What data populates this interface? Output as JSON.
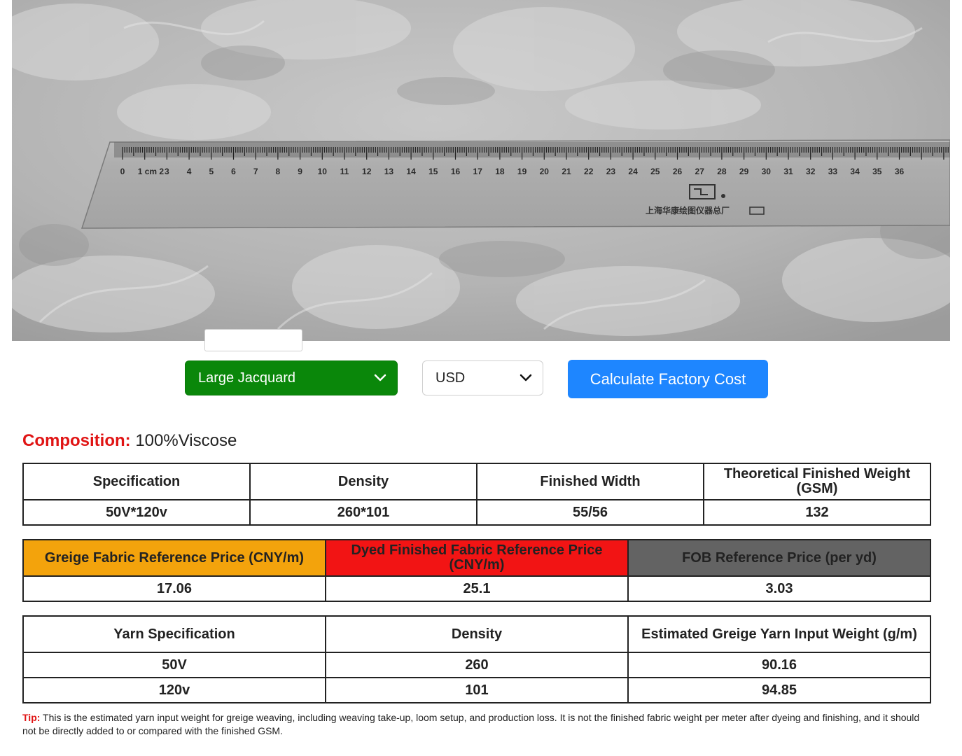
{
  "photo": {
    "ruler_numbers": [
      "0",
      "1 cm 2",
      "3",
      "4",
      "5",
      "6",
      "7",
      "8",
      "9",
      "10",
      "11",
      "12",
      "13",
      "14",
      "15",
      "16",
      "17",
      "18",
      "19",
      "20",
      "21",
      "22",
      "23",
      "24",
      "25",
      "26",
      "27",
      "28",
      "29",
      "30",
      "31",
      "32",
      "33",
      "34",
      "35",
      "36"
    ],
    "ruler_brand_text": "上海华康绘图仪器总厂"
  },
  "controls": {
    "process_select": {
      "selected": "Large Jacquard",
      "color": "#0a870a"
    },
    "currency_select": {
      "selected": "USD"
    },
    "calculate_label": "Calculate Factory Cost",
    "calculate_color": "#1e86ff"
  },
  "composition": {
    "label": "Composition:",
    "value": "100%Viscose"
  },
  "spec_table": {
    "headers": [
      "Specification",
      "Density",
      "Finished Width",
      "Theoretical Finished Weight (GSM)"
    ],
    "row": [
      "50V*120v",
      "260*101",
      "55/56",
      "132"
    ]
  },
  "price_table": {
    "headers": [
      "Greige Fabric Reference Price (CNY/m)",
      "Dyed Finished Fabric Reference Price (CNY/m)",
      "FOB Reference Price (per yd)"
    ],
    "header_colors": [
      "#f3a30c",
      "#f21414",
      "#636363"
    ],
    "row": [
      "17.06",
      "25.1",
      "3.03"
    ]
  },
  "yarn_table": {
    "headers": [
      "Yarn Specification",
      "Density",
      "Estimated Greige Yarn Input Weight (g/m)"
    ],
    "rows": [
      [
        "50V",
        "260",
        "90.16"
      ],
      [
        "120v",
        "101",
        "94.85"
      ]
    ]
  },
  "tip": {
    "label": "Tip:",
    "text": "This is the estimated yarn input weight for greige weaving, including weaving take-up, loom setup, and production loss. It is not the finished fabric weight per meter after dyeing and finishing, and it should not be directly added to or compared with the finished GSM."
  }
}
